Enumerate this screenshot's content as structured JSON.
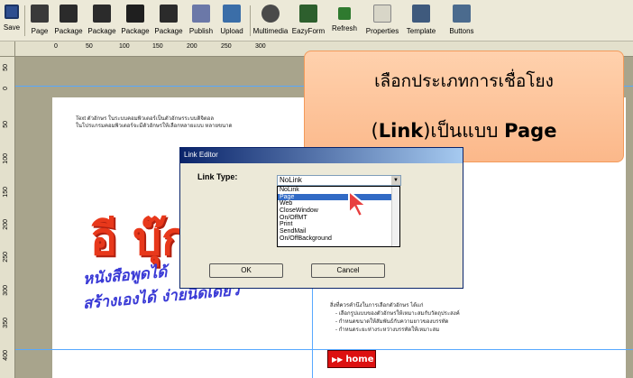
{
  "toolbar": {
    "items": [
      {
        "label": "Save",
        "icon": "save-icon"
      },
      {
        "label": "Page",
        "icon": "page-icon"
      },
      {
        "label": "Package",
        "icon": "package-icon"
      },
      {
        "label": "Package",
        "icon": "package-icon"
      },
      {
        "label": "Package",
        "icon": "package-icon"
      },
      {
        "label": "Package",
        "icon": "package-icon"
      },
      {
        "label": "Publish",
        "icon": "publish-icon"
      },
      {
        "label": "Upload",
        "icon": "upload-icon"
      },
      {
        "label": "Multimedia",
        "icon": "multimedia-icon"
      },
      {
        "label": "EazyForm",
        "icon": "form-icon"
      },
      {
        "label": "Refresh",
        "icon": "refresh-icon"
      },
      {
        "label": "Properties",
        "icon": "properties-icon"
      },
      {
        "label": "Template",
        "icon": "template-icon"
      },
      {
        "label": "Buttons",
        "icon": "buttons-icon"
      }
    ]
  },
  "ruler": {
    "top": [
      "0",
      "50",
      "100",
      "150",
      "200",
      "250",
      "300"
    ],
    "left": [
      "50",
      "0",
      "50",
      "100",
      "150",
      "200",
      "250",
      "300",
      "350",
      "400"
    ]
  },
  "page": {
    "text_line1": "Text ตัวอักษร ในระบบคอมพิวเตอร์เป็นตัวอักษรระบบดิจิตอล",
    "text_line2": "ในโปรแกรมคอมพิวเตอร์จะมีตัวอักษรให้เลือกหลายแบบ หลายขนาด",
    "big_title": "อี บุ๊ก",
    "subtitle1": "หนังสือพูดได้",
    "subtitle2": "สร้างเองได้ ง่ายนิดเดียว",
    "notes_title": "สิ่งที่ควรคำนึงในการเลือกตัวอักษร ได้แก่",
    "notes": [
      "- เลือกรูปแบบของตัวอักษรให้เหมาะสมกับวัตถุประสงค์",
      "- กำหนดขนาดให้สัมพันธ์กับความยาวของบรรทัด",
      "- กำหนดระยะห่างระหว่างบรรทัดให้เหมาะสม"
    ],
    "home_button": "home"
  },
  "callout": {
    "line1": "เลือกประเภทการเชื่อโยง",
    "line2_prefix": "(",
    "line2_link": "Link",
    "line2_mid": ")เป็นแบบ ",
    "line2_page": "Page"
  },
  "dialog": {
    "title": "Link Editor",
    "link_type_label": "Link Type:",
    "combo_value": "NoLink",
    "options": [
      "NoLink",
      "Page",
      "Web",
      "CloseWindow",
      "On/OffMT",
      "Print",
      "SendMail",
      "On/OffBackground"
    ],
    "selected": "Page",
    "ok": "OK",
    "cancel": "Cancel"
  },
  "colors": {
    "accent": "#316ac5",
    "title_red": "#e8381b",
    "subtitle_blue": "#3a3ad6",
    "callout": "#fbb88a"
  }
}
